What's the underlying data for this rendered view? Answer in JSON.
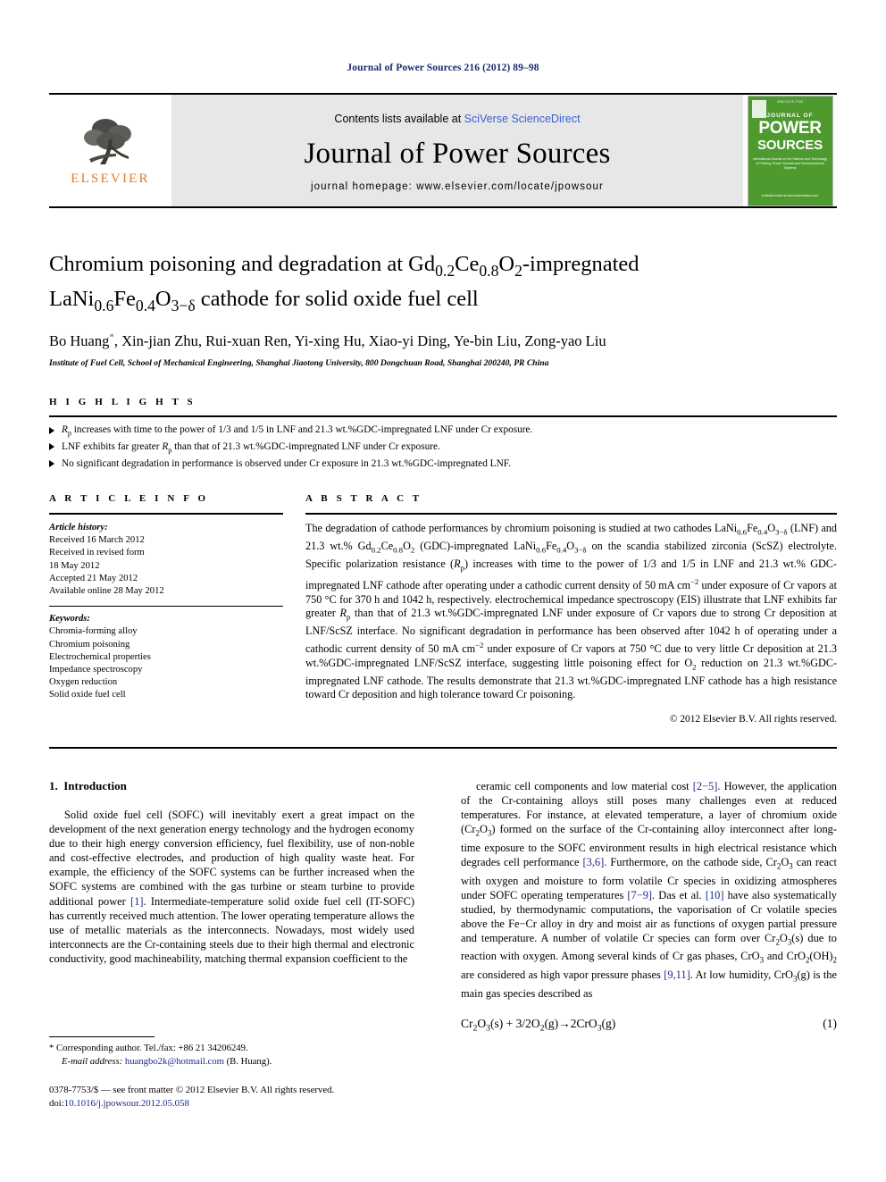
{
  "running_head": "Journal of Power Sources 216 (2012) 89–98",
  "masthead": {
    "publisher_name": "ELSEVIER",
    "contents_prefix": "Contents lists available at ",
    "contents_link": "SciVerse ScienceDirect",
    "journal_title": "Journal of Power Sources",
    "homepage": "journal homepage: www.elsevier.com/locate/jpowsour",
    "cover": {
      "top_text": "ISSN 0378-7753",
      "journal_of": "JOURNAL OF",
      "power": "POWER",
      "sources": "SOURCES",
      "subtitle": "International Journal on the Science and Technology of Fuelling, Power Sources and Electrochemical Systems",
      "footer": "Available online at www.sciencedirect.com"
    }
  },
  "article": {
    "title_line1_pre": "Chromium poisoning and degradation at Gd",
    "title_line1_sub1": "0.2",
    "title_line1_mid": "Ce",
    "title_line1_sub2": "0.8",
    "title_line1_mid2": "O",
    "title_line1_sub3": "2",
    "title_line1_post": "-impregnated",
    "title_line2_pre": "LaNi",
    "title_line2_sub1": "0.6",
    "title_line2_mid": "Fe",
    "title_line2_sub2": "0.4",
    "title_line2_mid2": "O",
    "title_line2_sub3": "3−δ",
    "title_line2_post": " cathode for solid oxide fuel cell",
    "title_plain": "Chromium poisoning and degradation at Gd0.2Ce0.8O2-impregnated LaNi0.6Fe0.4O3−δ cathode for solid oxide fuel cell",
    "authors": "Bo Huang, Xin-jian Zhu, Rui-xuan Ren, Yi-xing Hu, Xiao-yi Ding, Ye-bin Liu, Zong-yao Liu",
    "corresponding_marker": "*",
    "affiliation": "Institute of Fuel Cell, School of Mechanical Engineering, Shanghai Jiaotong University, 800 Dongchuan Road, Shanghai 200240, PR China"
  },
  "highlights": {
    "heading": "H I G H L I G H T S",
    "items": [
      "Rp increases with time to the power of 1/3 and 1/5 in LNF and 21.3 wt.%GDC-impregnated LNF under Cr exposure.",
      "LNF exhibits far greater Rp than that of 21.3 wt.%GDC-impregnated LNF under Cr exposure.",
      "No significant degradation in performance is observed under Cr exposure in 21.3 wt.%GDC-impregnated LNF."
    ]
  },
  "article_info": {
    "heading": "A R T I C L E   I N F O",
    "history_label": "Article history:",
    "history": [
      "Received 16 March 2012",
      "Received in revised form",
      "18 May 2012",
      "Accepted 21 May 2012",
      "Available online 28 May 2012"
    ],
    "keywords_label": "Keywords:",
    "keywords": [
      "Chromia-forming alloy",
      "Chromium poisoning",
      "Electrochemical properties",
      "Impedance spectroscopy",
      "Oxygen reduction",
      "Solid oxide fuel cell"
    ]
  },
  "abstract": {
    "heading": "A B S T R A C T",
    "text": "The degradation of cathode performances by chromium poisoning is studied at two cathodes LaNi0.6Fe0.4O3−δ (LNF) and 21.3 wt.% Gd0.2Ce0.8O2 (GDC)-impregnated LaNi0.6Fe0.4O3−δ on the scandia stabilized zirconia (ScSZ) electrolyte. Specific polarization resistance (Rp) increases with time to the power of 1/3 and 1/5 in LNF and 21.3 wt.% GDC-impregnated LNF cathode after operating under a cathodic current density of 50 mA cm−2 under exposure of Cr vapors at 750 °C for 370 h and 1042 h, respectively. electrochemical impedance spectroscopy (EIS) illustrate that LNF exhibits far greater Rp than that of 21.3 wt.%GDC-impregnated LNF under exposure of Cr vapors due to strong Cr deposition at LNF/ScSZ interface. No significant degradation in performance has been observed after 1042 h of operating under a cathodic current density of 50 mA cm−2 under exposure of Cr vapors at 750 °C due to very little Cr deposition at 21.3 wt.%GDC-impregnated LNF/ScSZ interface, suggesting little poisoning effect for O2 reduction on 21.3 wt.%GDC-impregnated LNF cathode. The results demonstrate that 21.3 wt.%GDC-impregnated LNF cathode has a high resistance toward Cr deposition and high tolerance toward Cr poisoning.",
    "copyright": "© 2012 Elsevier B.V. All rights reserved."
  },
  "introduction": {
    "section_number": "1.",
    "section_title": "Introduction",
    "left_paragraph": "Solid oxide fuel cell (SOFC) will inevitably exert a great impact on the development of the next generation energy technology and the hydrogen economy due to their high energy conversion efficiency, fuel flexibility, use of non-noble and cost-effective electrodes, and production of high quality waste heat. For example, the efficiency of the SOFC systems can be further increased when the SOFC systems are combined with the gas turbine or steam turbine to provide additional power [1]. Intermediate-temperature solid oxide fuel cell (IT-SOFC) has currently received much attention. The lower operating temperature allows the use of metallic materials as the interconnects. Nowadays, most widely used interconnects are the Cr-containing steels due to their high thermal and electronic conductivity, good machineability, matching thermal expansion coefficient to the",
    "right_paragraph": "ceramic cell components and low material cost [2−5]. However, the application of the Cr-containing alloys still poses many challenges even at reduced temperatures. For instance, at elevated temperature, a layer of chromium oxide (Cr2O3) formed on the surface of the Cr-containing alloy interconnect after long-time exposure to the SOFC environment results in high electrical resistance which degrades cell performance [3,6]. Furthermore, on the cathode side, Cr2O3 can react with oxygen and moisture to form volatile Cr species in oxidizing atmospheres under SOFC operating temperatures [7−9]. Das et al. [10] have also systematically studied, by thermodynamic computations, the vaporisation of Cr volatile species above the Fe−Cr alloy in dry and moist air as functions of oxygen partial pressure and temperature. A number of volatile Cr species can form over Cr2O3(s) due to reaction with oxygen. Among several kinds of Cr gas phases, CrO3 and CrO2(OH)2 are considered as high vapor pressure phases [9,11]. At low humidity, CrO3(g) is the main gas species described as",
    "equation_text": "Cr2O3(s) + 3/2O2(g)→2CrO3(g)",
    "equation_number": "(1)"
  },
  "footnotes": {
    "corresponding": "* Corresponding author. Tel./fax: +86 21 34206249.",
    "email_label": "E-mail address:",
    "email": "huangbo2k@hotmail.com",
    "email_suffix": "(B. Huang).",
    "imprint_line1": "0378-7753/$ — see front matter © 2012 Elsevier B.V. All rights reserved.",
    "doi_label": "doi:",
    "doi": "10.1016/j.jpowsour.2012.05.058"
  },
  "colors": {
    "link_blue": "#3a5fcd",
    "cite_blue": "#1a2a8c",
    "elsevier_orange": "#E87722",
    "cover_green": "#4e9a2f",
    "masthead_grey": "#e7e7e7"
  }
}
